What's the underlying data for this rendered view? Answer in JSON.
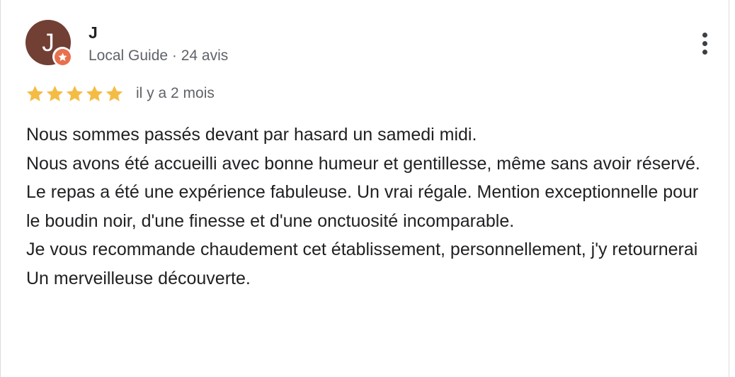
{
  "reviewer": {
    "avatar_initial": "J",
    "name": "J",
    "badge_icon": "local-guide-star-icon",
    "meta": "Local Guide · 24 avis"
  },
  "rating": {
    "stars": 5,
    "max_stars": 5,
    "date": "il y a 2 mois"
  },
  "review": {
    "lines": [
      "Nous sommes passés devant par hasard un samedi midi.",
      "Nous avons été accueilli avec bonne humeur et gentillesse, même sans avoir réservé.",
      "Le repas a été une expérience fabuleuse. Un vrai régale. Mention exceptionnelle pour le boudin noir, d'une finesse et d'une onctuosité incomparable.",
      "Je vous recommande chaudement cet établissement, personnellement, j'y retournerai",
      "Un merveilleuse découverte."
    ]
  },
  "colors": {
    "avatar_bg": "#713f34",
    "badge": "#e8704d",
    "star": "#f4bc44",
    "text_primary": "#202124",
    "text_secondary": "#5f6368"
  },
  "icons": {
    "menu": "more-vert-icon",
    "star": "star-icon"
  }
}
